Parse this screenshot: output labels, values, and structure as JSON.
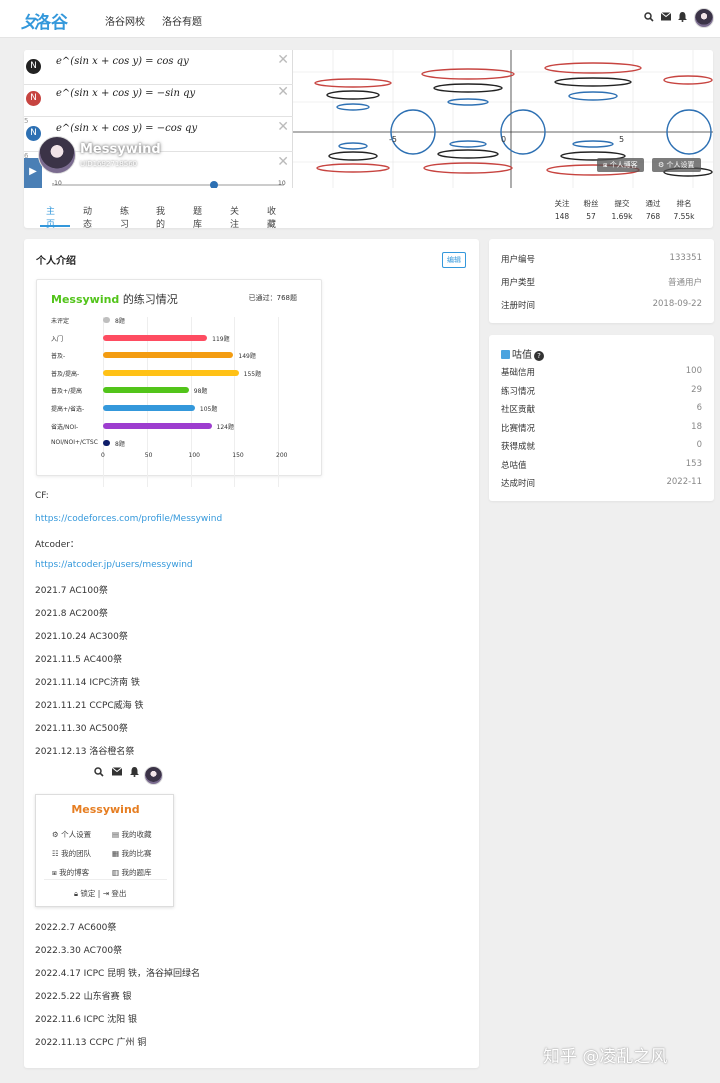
{
  "nav": {
    "logo": "洛谷",
    "links": [
      "洛谷网校",
      "洛谷有题"
    ]
  },
  "banner": {
    "equations": [
      {
        "num": "",
        "text": "e^(sin x + cos y) = cos qy"
      },
      {
        "num": "",
        "text": "e^(sin x + cos y) = −sin qy"
      },
      {
        "num": "5",
        "text": "e^(sin x + cos y) = −cos qy"
      },
      {
        "num": "6",
        "text": ""
      }
    ],
    "slider_min": "-10",
    "slider_max": "10",
    "axis_labels": [
      "-5",
      "0",
      "5"
    ]
  },
  "profile": {
    "username": "Messywind",
    "uid": "UID1692718560",
    "follow_btn": "个人博客",
    "settings_btn": "个人设置",
    "tabs": [
      "主页",
      "动态",
      "练习",
      "我的",
      "题库",
      "关注",
      "收藏"
    ],
    "stats": [
      {
        "label": "关注",
        "value": "148"
      },
      {
        "label": "粉丝",
        "value": "57"
      },
      {
        "label": "提交",
        "value": "1.69k"
      },
      {
        "label": "通过",
        "value": "768"
      },
      {
        "label": "排名",
        "value": "7.55k"
      }
    ]
  },
  "intro": {
    "title": "个人介绍",
    "edit": "编辑",
    "practice_title_name": "Messywind",
    "practice_title_rest": "的练习情况",
    "passed": "已通过：768题",
    "xticks": [
      "0",
      "50",
      "100",
      "150",
      "200"
    ],
    "lines_a": [
      {
        "text": "CF:",
        "link": false
      },
      {
        "text": "https://codeforces.com/profile/Messywind",
        "link": true
      },
      {
        "text": "Atcoder：",
        "link": false
      },
      {
        "text": "https://atcoder.jp/users/messywind",
        "link": true
      },
      {
        "text": "2021.7 AC100祭",
        "link": false
      },
      {
        "text": "2021.8 AC200祭",
        "link": false
      },
      {
        "text": "2021.10.24 AC300祭",
        "link": false
      },
      {
        "text": "2021.11.5 AC400祭",
        "link": false
      },
      {
        "text": "2021.11.14 ICPC济南 铁",
        "link": false
      },
      {
        "text": "2021.11.21 CCPC威海 铁",
        "link": false
      },
      {
        "text": "2021.11.30 AC500祭",
        "link": false
      },
      {
        "text": "2021.12.13 洛谷橙名祭",
        "link": false
      }
    ],
    "lines_b": [
      "2022.2.7 AC600祭",
      "2022.3.30 AC700祭",
      "2022.4.17 ICPC 昆明 铁，洛谷掉回绿名",
      "2022.5.22 山东省赛 银",
      "2022.11.6 ICPC 沈阳 银",
      "2022.11.13 CCPC 广州 铜"
    ]
  },
  "chart_data": {
    "type": "bar",
    "orientation": "horizontal",
    "title": "Messywind 的练习情况",
    "categories": [
      "未评定",
      "入门",
      "普及-",
      "普及/提高-",
      "普及+/提高",
      "提高+/省选-",
      "省选/NOI-",
      "NOI/NOI+/CTSC"
    ],
    "values": [
      8,
      119,
      149,
      155,
      98,
      105,
      124,
      8
    ],
    "value_labels": [
      "8题",
      "119题",
      "149题",
      "155题",
      "98题",
      "105题",
      "124题",
      "8题"
    ],
    "colors": [
      "#bfbfbf",
      "#fe4c61",
      "#f39c11",
      "#ffc116",
      "#52c41a",
      "#3498db",
      "#9d3dcf",
      "#0e1d69"
    ],
    "xlim": [
      0,
      200
    ],
    "grid": true
  },
  "menu": {
    "username": "Messywind",
    "items": [
      "个人设置",
      "我的收藏",
      "我的团队",
      "我的比赛",
      "我的博客",
      "我的题库"
    ],
    "lock": "锁定",
    "sep": "|",
    "logout": "登出"
  },
  "info": [
    {
      "label": "用户编号",
      "value": "133351"
    },
    {
      "label": "用户类型",
      "value": "普通用户"
    },
    {
      "label": "注册时间",
      "value": "2018-09-22"
    }
  ],
  "wealth": {
    "title": "咕值",
    "rows": [
      {
        "label": "基础信用",
        "value": "100"
      },
      {
        "label": "练习情况",
        "value": "29"
      },
      {
        "label": "社区贡献",
        "value": "6"
      },
      {
        "label": "比赛情况",
        "value": "18"
      },
      {
        "label": "获得成就",
        "value": "0"
      },
      {
        "label": "总咕值",
        "value": "153"
      },
      {
        "label": "达成时间",
        "value": "2022-11"
      }
    ]
  },
  "watermark": "知乎 @凌乱之风"
}
